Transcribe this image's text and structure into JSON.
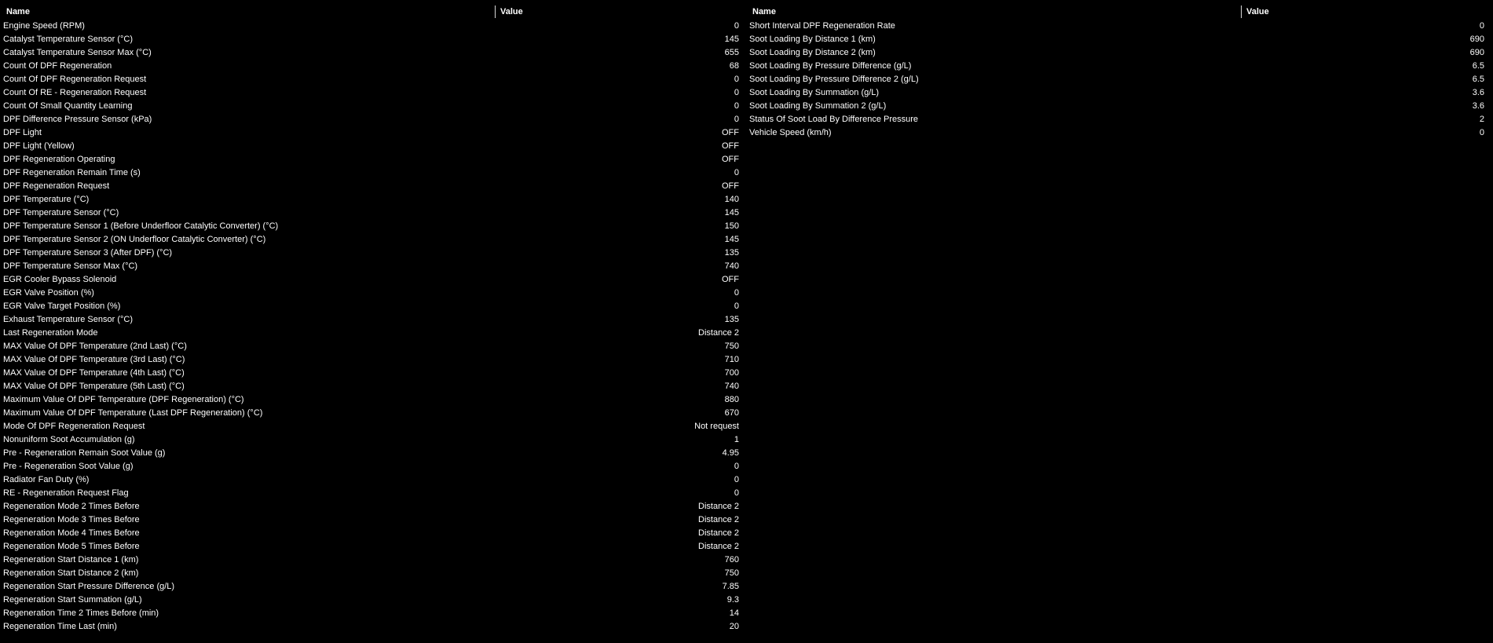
{
  "left_table": {
    "header_name": "Name",
    "header_value": "Value",
    "rows": [
      {
        "name": "Engine Speed (RPM)",
        "value": "0"
      },
      {
        "name": "Catalyst Temperature Sensor (°C)",
        "value": "145"
      },
      {
        "name": "Catalyst Temperature Sensor Max (°C)",
        "value": "655"
      },
      {
        "name": "Count Of DPF Regeneration",
        "value": "68"
      },
      {
        "name": "Count Of DPF Regeneration Request",
        "value": "0"
      },
      {
        "name": "Count Of RE - Regeneration Request",
        "value": "0"
      },
      {
        "name": "Count Of Small Quantity Learning",
        "value": "0"
      },
      {
        "name": "DPF Difference Pressure Sensor (kPa)",
        "value": "0"
      },
      {
        "name": "DPF Light",
        "value": "OFF"
      },
      {
        "name": "DPF Light (Yellow)",
        "value": "OFF"
      },
      {
        "name": "DPF Regeneration Operating",
        "value": "OFF"
      },
      {
        "name": "DPF Regeneration Remain Time (s)",
        "value": "0"
      },
      {
        "name": "DPF Regeneration Request",
        "value": "OFF"
      },
      {
        "name": "DPF Temperature (°C)",
        "value": "140"
      },
      {
        "name": "DPF Temperature Sensor (°C)",
        "value": "145"
      },
      {
        "name": "DPF Temperature Sensor 1 (Before Underfloor Catalytic Converter) (°C)",
        "value": "150"
      },
      {
        "name": "DPF Temperature Sensor 2 (ON Underfloor Catalytic Converter) (°C)",
        "value": "145"
      },
      {
        "name": "DPF Temperature Sensor 3 (After DPF) (°C)",
        "value": "135"
      },
      {
        "name": "DPF Temperature Sensor Max (°C)",
        "value": "740"
      },
      {
        "name": "EGR Cooler Bypass Solenoid",
        "value": "OFF"
      },
      {
        "name": "EGR Valve Position (%)",
        "value": "0"
      },
      {
        "name": "EGR Valve Target Position (%)",
        "value": "0"
      },
      {
        "name": "Exhaust Temperature Sensor (°C)",
        "value": "135"
      },
      {
        "name": "Last Regeneration Mode",
        "value": "Distance 2"
      },
      {
        "name": "MAX Value Of DPF Temperature (2nd Last) (°C)",
        "value": "750"
      },
      {
        "name": "MAX Value Of DPF Temperature (3rd Last) (°C)",
        "value": "710"
      },
      {
        "name": "MAX Value Of DPF Temperature (4th Last) (°C)",
        "value": "700"
      },
      {
        "name": "MAX Value Of DPF Temperature (5th Last) (°C)",
        "value": "740"
      },
      {
        "name": "Maximum Value Of DPF Temperature (DPF Regeneration) (°C)",
        "value": "880"
      },
      {
        "name": "Maximum Value Of DPF Temperature (Last DPF Regeneration) (°C)",
        "value": "670"
      },
      {
        "name": "Mode Of DPF Regeneration Request",
        "value": "Not request"
      },
      {
        "name": "Nonuniform Soot Accumulation (g)",
        "value": "1"
      },
      {
        "name": "Pre - Regeneration Remain Soot Value (g)",
        "value": "4.95"
      },
      {
        "name": "Pre - Regeneration Soot Value (g)",
        "value": "0"
      },
      {
        "name": "Radiator Fan Duty (%)",
        "value": "0"
      },
      {
        "name": "RE - Regeneration Request Flag",
        "value": "0"
      },
      {
        "name": "Regeneration Mode 2 Times Before",
        "value": "Distance 2"
      },
      {
        "name": "Regeneration Mode 3 Times Before",
        "value": "Distance 2"
      },
      {
        "name": "Regeneration Mode 4 Times Before",
        "value": "Distance 2"
      },
      {
        "name": "Regeneration Mode 5 Times Before",
        "value": "Distance 2"
      },
      {
        "name": "Regeneration Start Distance 1 (km)",
        "value": "760"
      },
      {
        "name": "Regeneration Start Distance 2 (km)",
        "value": "750"
      },
      {
        "name": "Regeneration Start Pressure Difference (g/L)",
        "value": "7.85"
      },
      {
        "name": "Regeneration Start Summation (g/L)",
        "value": "9.3"
      },
      {
        "name": "Regeneration Time 2 Times Before (min)",
        "value": "14"
      },
      {
        "name": "Regeneration Time Last (min)",
        "value": "20"
      }
    ]
  },
  "right_table": {
    "header_name": "Name",
    "header_value": "Value",
    "rows": [
      {
        "name": "Short Interval DPF Regeneration Rate",
        "value": "0"
      },
      {
        "name": "Soot Loading By Distance 1 (km)",
        "value": "690"
      },
      {
        "name": "Soot Loading By Distance 2 (km)",
        "value": "690"
      },
      {
        "name": "Soot Loading By Pressure Difference (g/L)",
        "value": "6.5"
      },
      {
        "name": "Soot Loading By Pressure Difference 2 (g/L)",
        "value": "6.5"
      },
      {
        "name": "Soot Loading By Summation (g/L)",
        "value": "3.6"
      },
      {
        "name": "Soot Loading By Summation 2 (g/L)",
        "value": "3.6"
      },
      {
        "name": "Status Of Soot Load By Difference Pressure",
        "value": "2"
      },
      {
        "name": "Vehicle Speed (km/h)",
        "value": "0"
      }
    ]
  }
}
